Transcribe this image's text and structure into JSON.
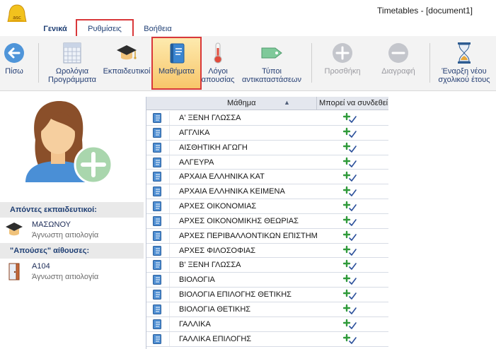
{
  "window": {
    "title": "Timetables - [document1]"
  },
  "tabs": [
    {
      "label": "Γενικά"
    },
    {
      "label": "Ρυθμίσεις"
    },
    {
      "label": "Βοήθεια"
    }
  ],
  "ribbon": {
    "back_label": "Πίσω",
    "schedules_label_1": "Ωρολόγια",
    "schedules_label_2": "Προγράμματα",
    "teachers_label": "Εκπαιδευτικοί",
    "subjects_label": "Μαθήματα",
    "absence_label_1": "Λόγοι",
    "absence_label_2": "απουσίας",
    "subst_label_1": "Τύποι",
    "subst_label_2": "αντικαταστάσεων",
    "add_label": "Προσθήκη",
    "delete_label": "Διαγραφή",
    "new_year_label_1": "Έναρξη νέου",
    "new_year_label_2": "σχολικού έτους"
  },
  "left": {
    "absent_teachers_header": "Απόντες εκπαιδευτικοί:",
    "absent_teacher": {
      "name": "ΜΑΣΩΝΟΥ",
      "reason": "Άγνωστη αιτιολογία"
    },
    "absent_rooms_header": "\"Απούσες\" αίθουσες:",
    "absent_room": {
      "name": "Α104",
      "reason": "Άγνωστη αιτιολογία"
    }
  },
  "grid": {
    "col_subject": "Μάθημα",
    "col_can_connect": "Μπορεί να συνδεθεί",
    "rows": [
      "Α' ΞΕΝΗ ΓΛΩΣΣΑ",
      "ΑΓΓΛΙΚΑ",
      "ΑΙΣΘΗΤΙΚΗ ΑΓΩΓΗ",
      "ΑΛΓΕΥΡΑ",
      "ΑΡΧΑΙΑ ΕΛΛΗΝΙΚΑ ΚΑΤ",
      "ΑΡΧΑΙΑ ΕΛΛΗΝΙΚΑ ΚΕΙΜΕΝΑ",
      "ΑΡΧΕΣ ΟΙΚΟΝΟΜΙΑΣ",
      "ΑΡΧΕΣ ΟΙΚΟΝΟΜΙΚΗΣ ΘΕΩΡΙΑΣ",
      "ΑΡΧΕΣ ΠΕΡΙΒΑΛΛΟΝΤΙΚΩΝ ΕΠΙΣΤΗΜ",
      "ΑΡΧΕΣ ΦΙΛΟΣΟΦΙΑΣ",
      "Β' ΞΕΝΗ ΓΛΩΣΣΑ",
      "ΒΙΟΛΟΓΙΑ",
      "ΒΙΟΛΟΓΙΑ ΕΠΙΛΟΓΗΣ ΘΕΤΙΚΗΣ",
      "ΒΙΟΛΟΓΙΑ ΘΕΤΙΚΗΣ",
      "ΓΑΛΛΙΚΑ",
      "ΓΑΛΛΙΚΑ ΕΠΙΛΟΓΗΣ"
    ]
  },
  "colors": {
    "accent_blue": "#1f3f74",
    "highlight_red": "#d9383a",
    "selected_gradient_top": "#fdebb0",
    "selected_gradient_bottom": "#f8c66a"
  }
}
